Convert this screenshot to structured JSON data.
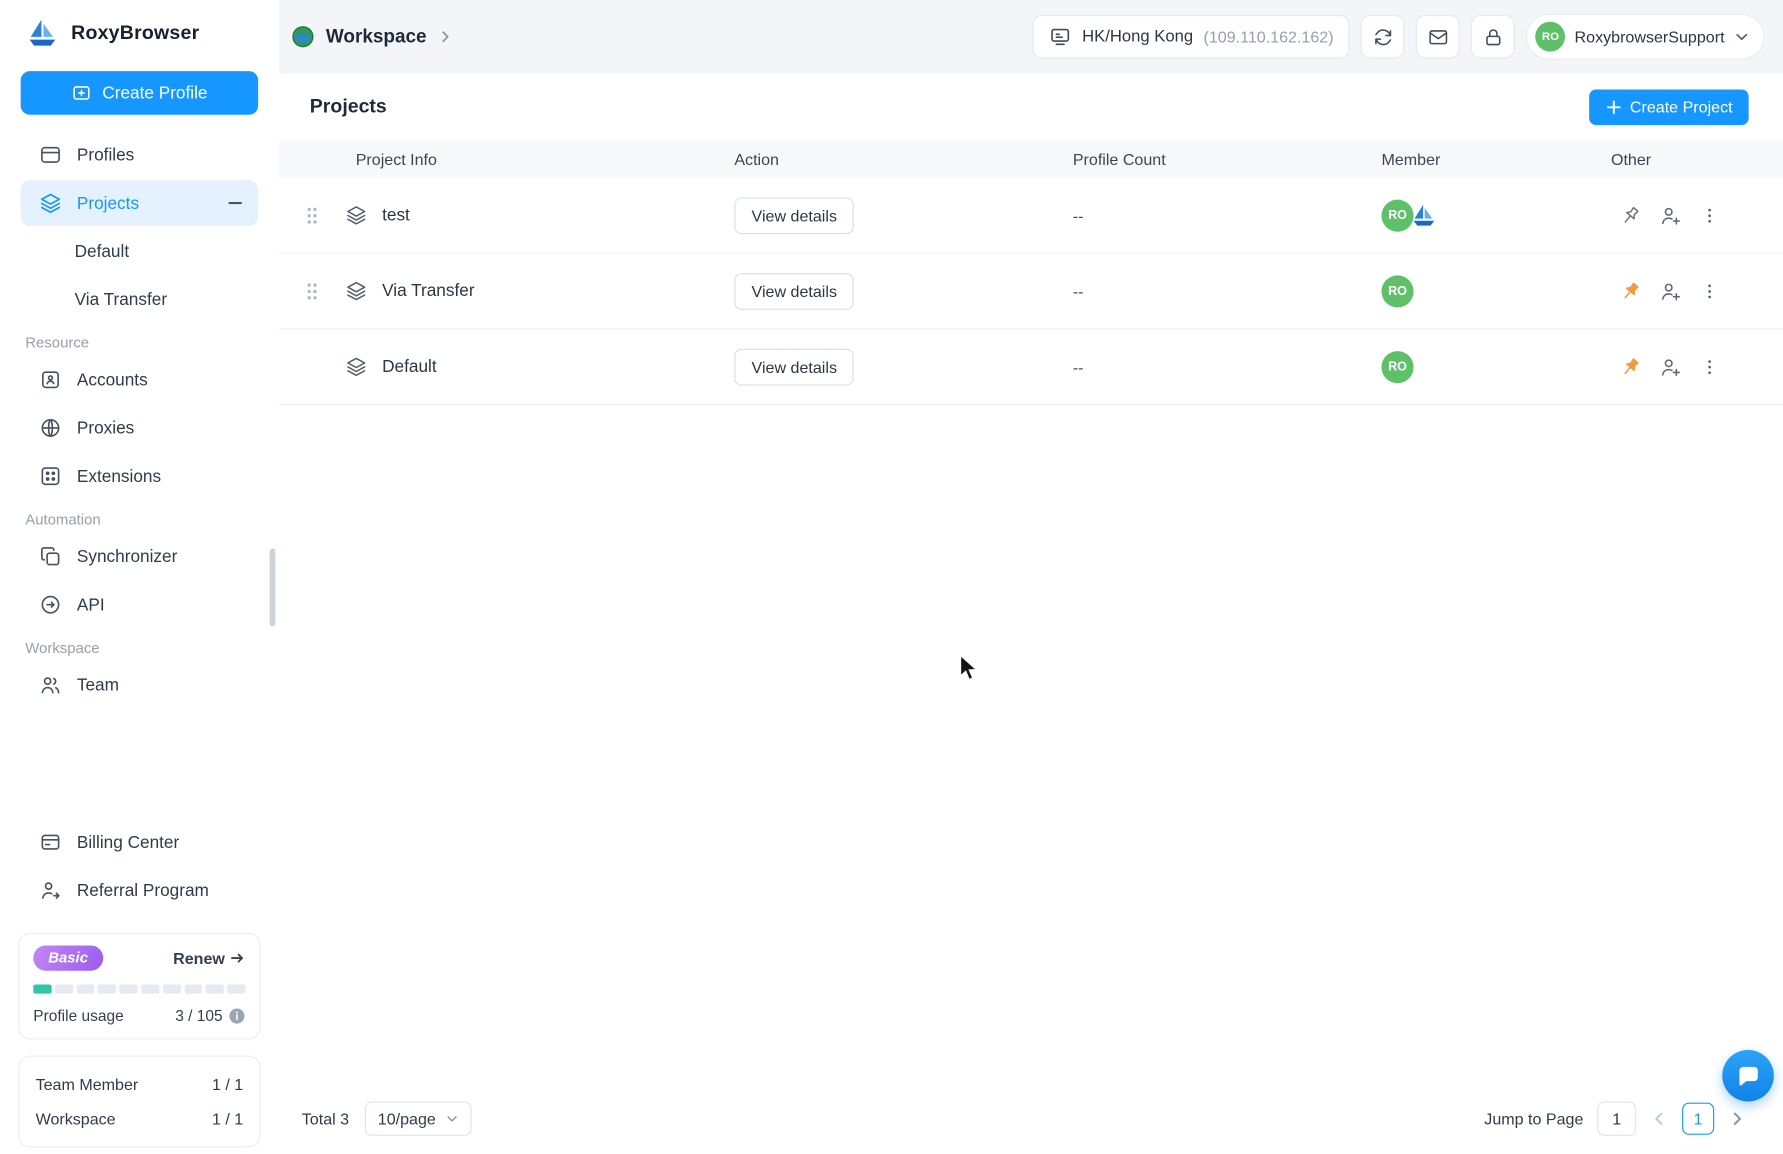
{
  "colors": {
    "accent_blue": "#1697ff",
    "active_nav_bg": "#e4f1fe",
    "pin_orange": "#f29a3e",
    "avatar_green": "#5fc06a",
    "progress_teal": "#2fc7a7",
    "badge_purple": "#9a5cf0"
  },
  "app": {
    "name": "RoxyBrowser"
  },
  "sidebar": {
    "create_profile_label": "Create Profile",
    "nav": [
      {
        "label": "Profiles"
      },
      {
        "label": "Projects"
      }
    ],
    "projects_children": [
      "Default",
      "Via Transfer"
    ],
    "sections": [
      {
        "title": "Resource",
        "items": [
          {
            "label": "Accounts"
          },
          {
            "label": "Proxies"
          },
          {
            "label": "Extensions"
          }
        ]
      },
      {
        "title": "Automation",
        "items": [
          {
            "label": "Synchronizer"
          },
          {
            "label": "API"
          }
        ]
      },
      {
        "title": "Workspace",
        "items": [
          {
            "label": "Team"
          }
        ]
      }
    ],
    "footer_links": [
      {
        "label": "Billing Center"
      },
      {
        "label": "Referral Program"
      }
    ],
    "plan": {
      "badge": "Basic",
      "renew_label": "Renew",
      "usage_label": "Profile usage",
      "usage_value": "3 / 105",
      "segments_total": 10,
      "segments_filled": 1
    },
    "stats": [
      {
        "label": "Team Member",
        "value": "1 / 1"
      },
      {
        "label": "Workspace",
        "value": "1 / 1"
      }
    ]
  },
  "header": {
    "breadcrumb": "Workspace",
    "location": {
      "name": "HK/Hong Kong",
      "ip": "(109.110.162.162)"
    },
    "account": {
      "name": "RoxybrowserSupport",
      "initials": "RO"
    }
  },
  "main": {
    "title": "Projects",
    "create_project_label": "Create Project",
    "table": {
      "columns": [
        "Project Info",
        "Action",
        "Profile Count",
        "Member",
        "Other"
      ],
      "rows": [
        {
          "name": "test",
          "action": "View details",
          "profile_count": "--",
          "member_initials": "RO",
          "pinned": false,
          "has_team_logo": true,
          "draggable": true
        },
        {
          "name": "Via Transfer",
          "action": "View details",
          "profile_count": "--",
          "member_initials": "RO",
          "pinned": true,
          "has_team_logo": false,
          "draggable": true
        },
        {
          "name": "Default",
          "action": "View details",
          "profile_count": "--",
          "member_initials": "RO",
          "pinned": true,
          "has_team_logo": false,
          "draggable": false
        }
      ]
    },
    "pagination": {
      "total": "Total 3",
      "page_size": "10/page",
      "jump_label": "Jump to Page",
      "jump_value": "1",
      "current_page": "1"
    }
  }
}
